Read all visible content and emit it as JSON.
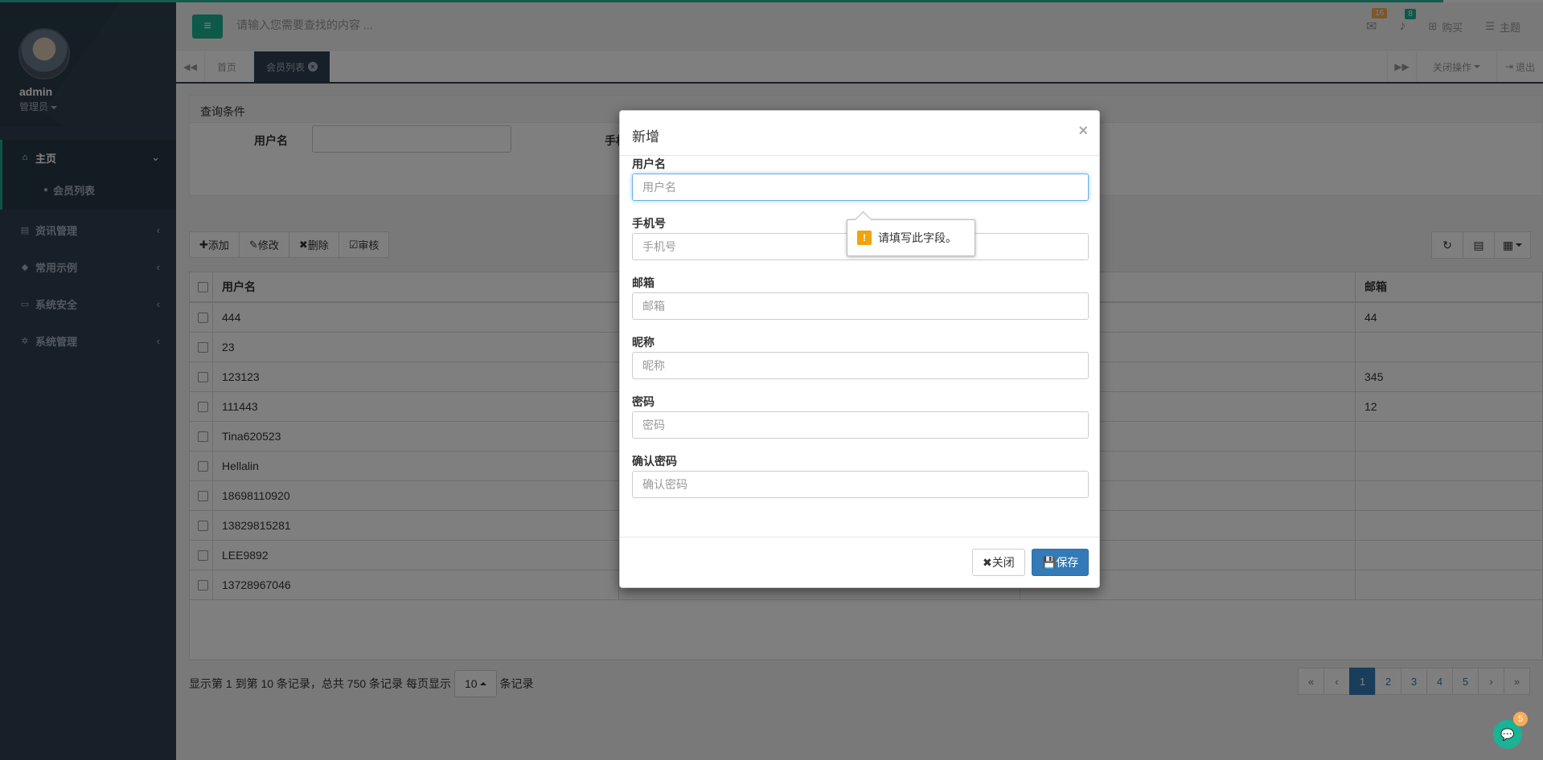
{
  "colors": {
    "brand": "#1ab394",
    "sidebar": "#2f4050",
    "primary": "#337ab7",
    "warning": "#f8ac59"
  },
  "sidebar": {
    "user_name": "admin",
    "user_role": "管理员",
    "menu": [
      {
        "label": "主页",
        "icon": "home-icon"
      },
      {
        "label": "资讯管理",
        "icon": "document-icon"
      },
      {
        "label": "常用示例",
        "icon": "tags-icon"
      },
      {
        "label": "系统安全",
        "icon": "desktop-icon"
      },
      {
        "label": "系统管理",
        "icon": "cogs-icon"
      }
    ],
    "sub_item": "会员列表"
  },
  "header": {
    "search_placeholder": "请输入您需要查找的内容 ...",
    "mail_count": "16",
    "bell_count": "8",
    "buy_label": "购买",
    "theme_label": "主题"
  },
  "tabs": {
    "home": "首页",
    "active": "会员列表",
    "close_ops": "关闭操作",
    "logout": "退出"
  },
  "query": {
    "title": "查询条件",
    "username_label": "用户名",
    "phone_label": "手机号"
  },
  "toolbar": {
    "add": "添加",
    "edit": "修改",
    "delete": "删除",
    "audit": "审核"
  },
  "table": {
    "headers": [
      "用户名",
      "邮箱"
    ],
    "rows": [
      {
        "username": "444",
        "email": "44"
      },
      {
        "username": "23",
        "email": ""
      },
      {
        "username": "123123",
        "email": "345"
      },
      {
        "username": "111443",
        "email": "12"
      },
      {
        "username": "Tina620523",
        "email": ""
      },
      {
        "username": "Hellalin",
        "email": ""
      },
      {
        "username": "18698110920",
        "email": ""
      },
      {
        "username": "13829815281",
        "email": ""
      },
      {
        "username": "LEE9892",
        "email": ""
      },
      {
        "username": "13728967046",
        "email": ""
      }
    ]
  },
  "footer": {
    "info": "显示第 1 到第 10 条记录，总共 750 条记录 每页显示",
    "page_size": "10",
    "suffix": "条记录",
    "pages": [
      "«",
      "‹",
      "1",
      "2",
      "3",
      "4",
      "5",
      "›",
      "»"
    ]
  },
  "modal": {
    "title": "新增",
    "fields": [
      {
        "label": "用户名",
        "placeholder": "用户名"
      },
      {
        "label": "手机号",
        "placeholder": "手机号"
      },
      {
        "label": "邮箱",
        "placeholder": "邮箱"
      },
      {
        "label": "昵称",
        "placeholder": "昵称"
      },
      {
        "label": "密码",
        "placeholder": "密码"
      },
      {
        "label": "确认密码",
        "placeholder": "确认密码"
      }
    ],
    "close_label": "关闭",
    "save_label": "保存",
    "tooltip": "请填写此字段。"
  },
  "chat": {
    "count": "5"
  }
}
